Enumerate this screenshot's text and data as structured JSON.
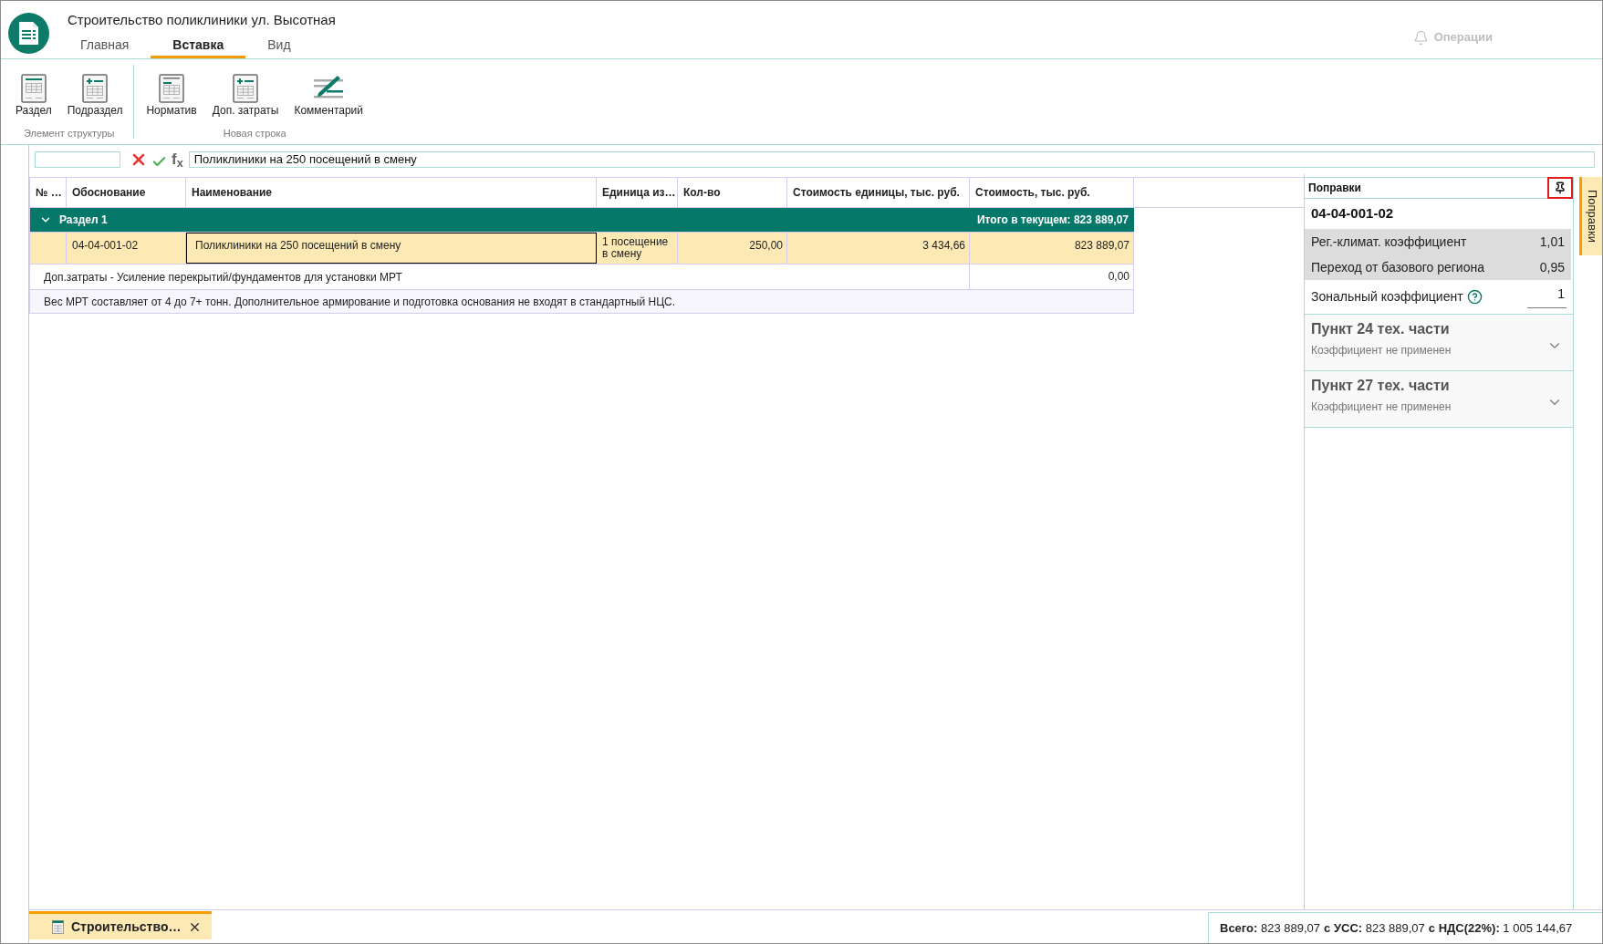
{
  "window": {
    "title": "Строительство поликлиники ул. Высотная"
  },
  "ribbon_tabs": [
    {
      "label": "Главная",
      "selected": false
    },
    {
      "label": "Вставка",
      "selected": true
    },
    {
      "label": "Вид",
      "selected": false
    }
  ],
  "operations": {
    "label": "Операции",
    "disabled": true
  },
  "ribbon_groups": [
    {
      "label": "Элемент структуры",
      "buttons": [
        {
          "kind": "section",
          "label": "Раздел"
        },
        {
          "kind": "subsection",
          "label": "Подраздел"
        }
      ]
    },
    {
      "label": "Новая строка",
      "buttons": [
        {
          "kind": "norm",
          "label": "Норматив"
        },
        {
          "kind": "extra_costs",
          "label": "Доп. затраты"
        },
        {
          "kind": "comment",
          "label": "Комментарий"
        }
      ]
    }
  ],
  "formula_bar": {
    "function_label": "f$_{x}$",
    "value": "Поликлиники на 250 посещений в смену"
  },
  "table": {
    "columns": [
      "№ …",
      "Обоснование",
      "Наименование",
      "Единица из…",
      "Кол-во",
      "Стоимость единицы, тыс. руб.",
      "Стоимость, тыс. руб."
    ],
    "rows": [
      {
        "kind": "section",
        "label": "Раздел 1",
        "expanded": true,
        "total": "Итого в текущем: 823 889,07"
      },
      {
        "kind": "item",
        "selected": true,
        "name_focused": true,
        "code": "04-04-001-02",
        "name": "Поликлиники на 250 посещений в смену",
        "unit": "1 посещение в смену",
        "quantity": "250,00",
        "unit_cost": "3 434,66",
        "cost": "823 889,07"
      },
      {
        "kind": "extra_cost",
        "text": "Доп.затраты - Усиление перекрытий/фундаментов для установки МРТ",
        "cost": "0,00"
      },
      {
        "kind": "comment",
        "text": "Вес МРТ составляет от 4 до 7+ тонн. Дополнительное армирование и подготовка основания не входят в стандартный НЦС."
      }
    ]
  },
  "corrections_panel": {
    "title": "Поправки",
    "pin": {
      "highlighted": true
    },
    "code": "04-04-001-02",
    "coefficients": [
      {
        "kind": "readonly",
        "label": "Рег.-климат. коэффициент",
        "value": "1,01"
      },
      {
        "kind": "readonly",
        "label": "Переход от базового региона",
        "value": "0,95"
      },
      {
        "kind": "input",
        "label": "Зональный коэффициент",
        "help": true,
        "value": "1"
      }
    ],
    "sections": [
      {
        "title": "Пункт 24 тех. части",
        "subtitle": "Коэффициент не применен",
        "expanded": false
      },
      {
        "title": "Пункт 27 тех. части",
        "subtitle": "Коэффициент не применен",
        "expanded": false
      }
    ]
  },
  "side_tabs": [
    {
      "label": "Поправки",
      "selected": true
    }
  ],
  "document_tabs": [
    {
      "label": "Строительство…",
      "selected": true
    }
  ],
  "status_bar": {
    "totals": [
      {
        "label": "Всего:",
        "value": "823 889,07"
      },
      {
        "label": "с УСС:",
        "value": "823 889,07"
      },
      {
        "label": "с НДС(22%):",
        "value": "1 005 144,67"
      }
    ]
  }
}
